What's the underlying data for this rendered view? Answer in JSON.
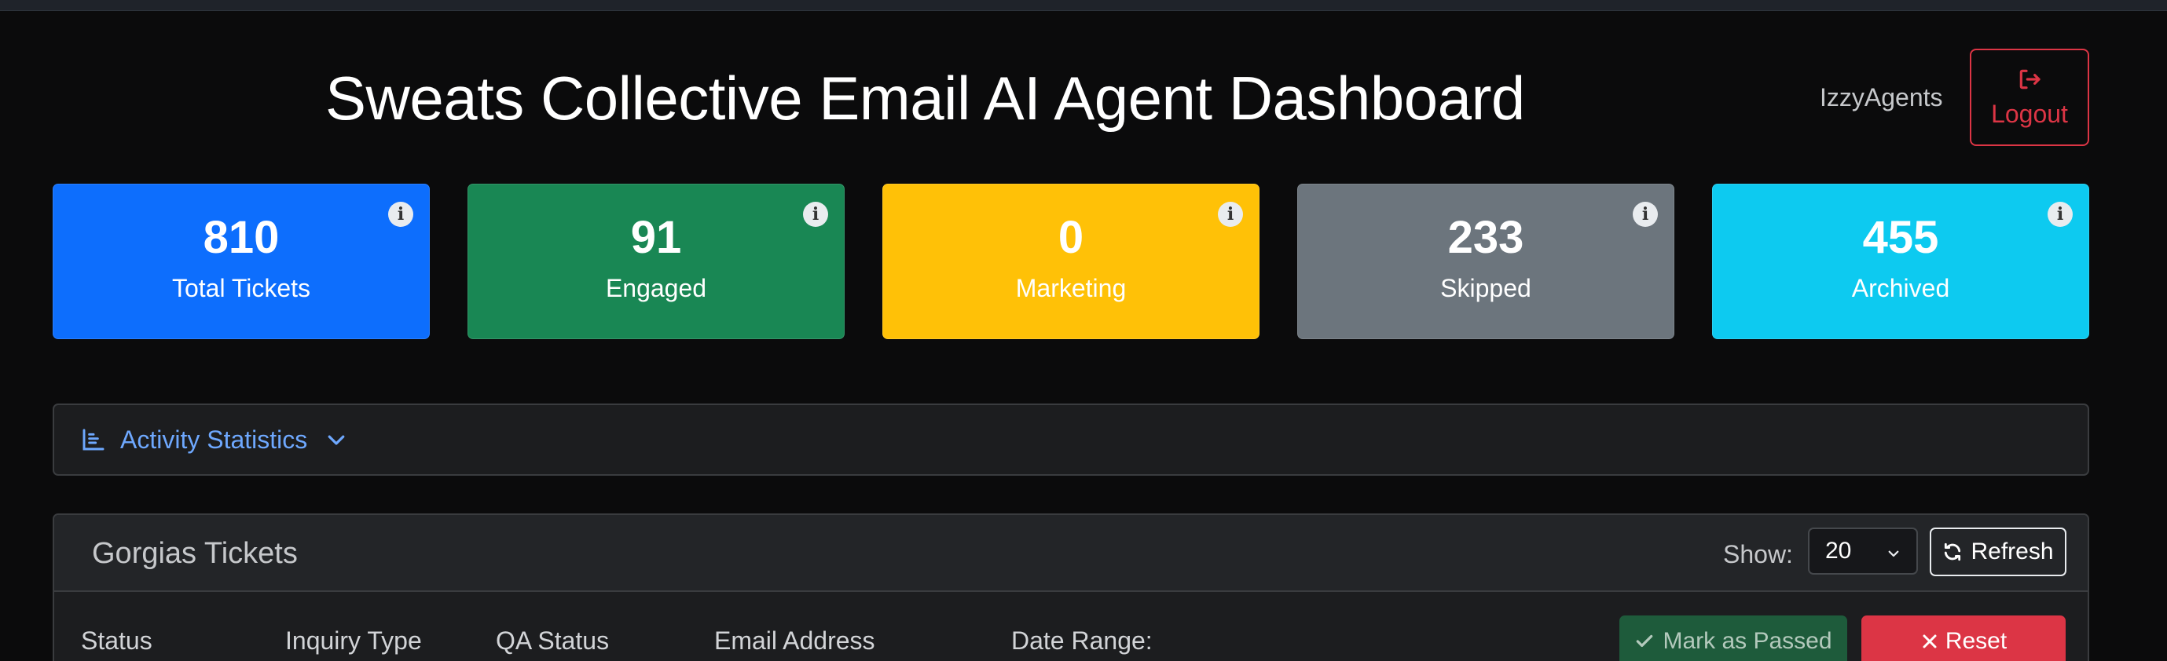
{
  "header": {
    "title": "Sweats Collective Email AI Agent Dashboard",
    "user_name": "IzzyAgents",
    "logout_label": "Logout"
  },
  "stats": [
    {
      "value": "810",
      "label": "Total Tickets",
      "color": "#0d6efd",
      "info_glyph": "i"
    },
    {
      "value": "91",
      "label": "Engaged",
      "color": "#198754",
      "info_glyph": "i"
    },
    {
      "value": "0",
      "label": "Marketing",
      "color": "#ffc107",
      "info_glyph": "i"
    },
    {
      "value": "233",
      "label": "Skipped",
      "color": "#6c757d",
      "info_glyph": "i"
    },
    {
      "value": "455",
      "label": "Archived",
      "color": "#0dcaf0",
      "info_glyph": "i"
    }
  ],
  "activity": {
    "label": "Activity Statistics",
    "icon": "bar-chart-icon",
    "expanded": false
  },
  "tickets": {
    "title": "Gorgias Tickets",
    "show_label": "Show:",
    "page_size": "20",
    "refresh_label": "Refresh",
    "filters": {
      "status": "Status",
      "inquiry_type": "Inquiry Type",
      "qa_status": "QA Status",
      "email_address": "Email Address",
      "date_range": "Date Range:"
    },
    "mark_passed_label": "Mark as Passed",
    "reset_label": "Reset"
  },
  "colors": {
    "background": "#0b0b0c",
    "danger": "#dc3545",
    "link": "#6ea8fe",
    "success_dark": "#1e5b3b"
  }
}
